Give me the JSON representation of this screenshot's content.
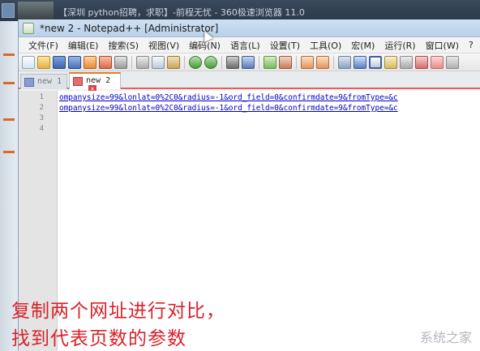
{
  "background": {
    "browser_title": "【深圳 python招聘，求职】-前程无忧 - 360极速浏览器 11.0"
  },
  "window": {
    "title": "*new 2 - Notepad++ [Administrator]"
  },
  "menu": [
    "文件(F)",
    "编辑(E)",
    "搜索(S)",
    "视图(V)",
    "编码(N)",
    "语言(L)",
    "设置(T)",
    "工具(O)",
    "宏(M)",
    "运行(R)",
    "窗口(W)",
    "?"
  ],
  "tabs": [
    {
      "label": "new 1",
      "active": false
    },
    {
      "label": "new 2",
      "active": true
    }
  ],
  "editor": {
    "line_numbers": [
      "1",
      "2",
      "3",
      "4"
    ],
    "lines": [
      "ompanysize=99&lonlat=0%2C0&radius=-1&ord_field=0&confirmdate=9&fromType=&c",
      "ompanysize=99&lonlat=0%2C0&radius=-1&ord_field=0&confirmdate=9&fromType=&c",
      "",
      ""
    ]
  },
  "caption": {
    "line1": "复制两个网址进行对比，",
    "line2": "找到代表页数的参数"
  },
  "watermark": "系统之家",
  "colors": {
    "caption": "#d8222a",
    "link_text": "#0000c8",
    "active_tab_accent": "#e67b2c"
  }
}
